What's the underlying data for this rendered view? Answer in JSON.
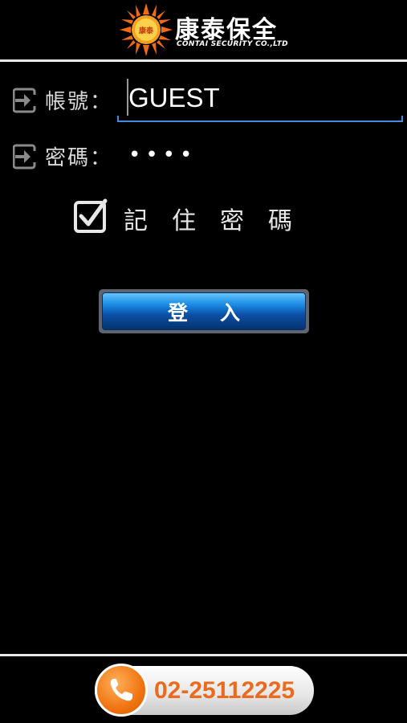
{
  "header": {
    "logo_badge": "康泰",
    "brand_name": "康泰保全",
    "brand_subtitle": "CONTAI SECURITY CO.,LTD"
  },
  "form": {
    "username_label": "帳號：",
    "username_value": "GUEST",
    "password_label": "密碼：",
    "password_masked": "••••",
    "remember_label": "記住密碼",
    "remember_checked": true,
    "login_button": "登入"
  },
  "footer": {
    "phone_number": "02-25112225"
  },
  "icons": {
    "username": "login-arrow-icon",
    "password": "login-arrow-icon",
    "checkbox": "checkbox-checked-icon",
    "phone": "phone-icon",
    "logo": "sun-logo-icon"
  },
  "colors": {
    "background": "#000000",
    "accent_blue": "#3d8de0",
    "button_blue": "#1a8ae4",
    "brand_orange": "#f07412",
    "phone_text": "#ea6a1e"
  }
}
